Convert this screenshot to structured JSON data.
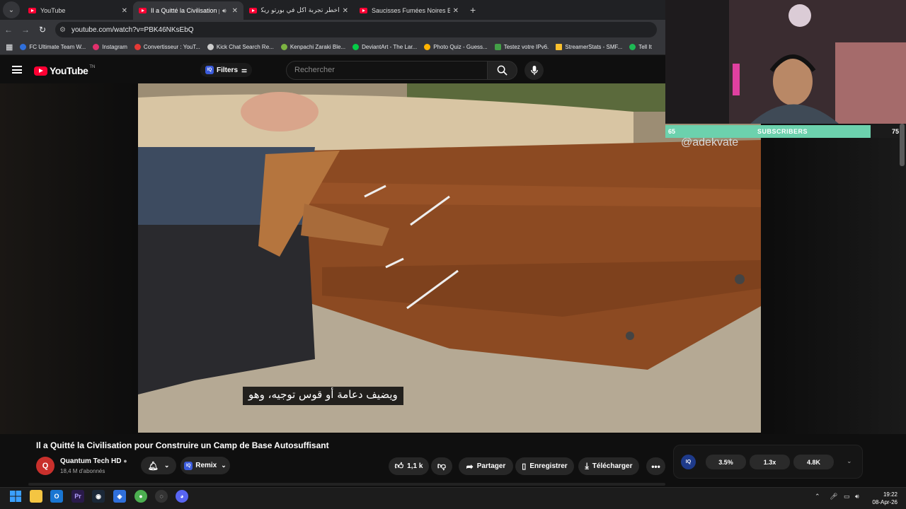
{
  "browser": {
    "tabs": [
      {
        "title": "YouTube",
        "active": false
      },
      {
        "title": "Il a Quitté la Civilisation pour",
        "active": true
      },
      {
        "title": "أخطر تجربة أكل في بورتو ريكو...",
        "active": false
      },
      {
        "title": "Saucisses Fumées Noires Bushcraft",
        "active": false
      }
    ],
    "new_tab": "+",
    "url": "youtube.com/watch?v=PBK46NKsEbQ",
    "bookmarks": [
      {
        "label": "FC Ultimate Team W...",
        "color": "#2f6fdb"
      },
      {
        "label": "Instagram",
        "color": "#e1306c"
      },
      {
        "label": "Convertisseur : YouT...",
        "color": "#e53935"
      },
      {
        "label": "Kick Chat Search Re...",
        "color": "#cccccc"
      },
      {
        "label": "Kenpachi Zaraki Ble...",
        "color": "#7cb342"
      },
      {
        "label": "DeviantArt - The Lar...",
        "color": "#05cc47"
      },
      {
        "label": "Photo Quiz - Guess...",
        "color": "#ffb300"
      },
      {
        "label": "Testez votre IPv6.",
        "color": "#43a047"
      },
      {
        "label": "StreamerStats - SMF...",
        "color": "#fbc02d"
      },
      {
        "label": "Tell It",
        "color": "#1db954"
      }
    ]
  },
  "youtube": {
    "logo": "YouTube",
    "logo_suffix": "TN",
    "filters_label": "Filters",
    "search_placeholder": "Rechercher"
  },
  "video": {
    "subtitle": "ويضيف دعامة أو قوس توجيه، وهو",
    "overlay_handle": "@adekvate",
    "title": "Il a Quitté la Civilisation pour Construire un Camp de Base Autosuffisant",
    "channel": {
      "name": "Quantum Tech HD",
      "subscribers": "18,4 M d'abonnés"
    },
    "actions": {
      "remix": "Remix",
      "likes": "1,1 k",
      "share": "Partager",
      "save": "Enregistrer",
      "download": "Télécharger"
    }
  },
  "stream_overlay": {
    "subs_label": "SUBSCRIBERS",
    "subs_current": "65",
    "subs_goal": "75",
    "subs_progress": 0.87
  },
  "iq_panel": {
    "logo": "IQ",
    "stats": [
      "3.5%",
      "1.3x",
      "4.8K"
    ]
  },
  "taskbar": {
    "time": "19:22",
    "date": "08-Apr-26"
  }
}
